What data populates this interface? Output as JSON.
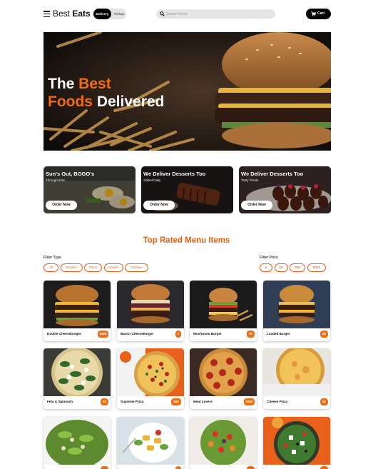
{
  "header": {
    "brand_regular": "Best",
    "brand_bold": "Eats",
    "toggle_on": "Delivery",
    "toggle_off": "Pickup",
    "search_placeholder": "Search foods",
    "cart_label": "Cart"
  },
  "hero": {
    "line1_white": "The ",
    "line1_orange": "Best",
    "line2_orange": "Foods",
    "line2_white": " Delivered"
  },
  "promos": [
    {
      "title": "Sun's Out, BOGO's",
      "subtitle": "Through 8/26",
      "button": "Order Now"
    },
    {
      "title": "We Deliver Desserts Too",
      "subtitle": "Added Daily",
      "button": "Order Now"
    },
    {
      "title": "We Deliver Desserts Too",
      "subtitle": "Tasty Treats",
      "button": "Order Now"
    }
  ],
  "section_title": "Top Rated Menu Items",
  "filters": {
    "type_label": "Filter Type",
    "types": [
      "All",
      "Burgers",
      "Pizza",
      "Salads",
      "Chicken"
    ],
    "price_label": "Filter Price",
    "prices": [
      "$",
      "$$",
      "$$$",
      "$$$$"
    ]
  },
  "menu_items": [
    {
      "name": "Double Cheeseburger",
      "price": "$$$$"
    },
    {
      "name": "Bacon Cheeseburger",
      "price": "$"
    },
    {
      "name": "Mushroom Burger",
      "price": "$$"
    },
    {
      "name": "Loaded Burger",
      "price": "$$"
    },
    {
      "name": "Feta & Spinnach",
      "price": "$$"
    },
    {
      "name": "Supreme Pizza",
      "price": "$$$"
    },
    {
      "name": "Meat Lovers",
      "price": "$$$$"
    },
    {
      "name": "Cheese Pizza",
      "price": "$$"
    }
  ],
  "colors": {
    "accent": "#f26b0f",
    "accent_text": "#e8601a",
    "dark": "#000000"
  }
}
